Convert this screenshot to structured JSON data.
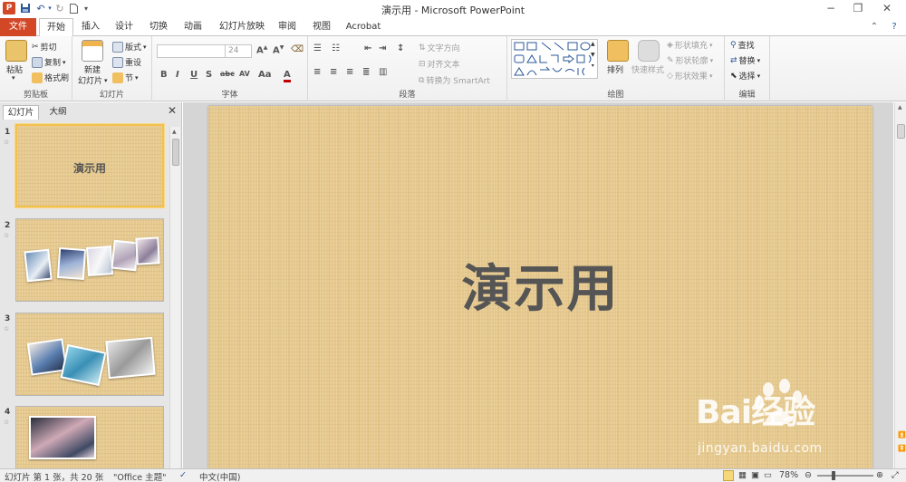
{
  "window": {
    "title": "演示用 - Microsoft PowerPoint",
    "controls": {
      "minimize": "−",
      "restore": "❐",
      "close": "✕"
    }
  },
  "tabs": [
    {
      "label": "文件",
      "state": "file"
    },
    {
      "label": "开始",
      "state": "active"
    },
    {
      "label": "插入"
    },
    {
      "label": "设计"
    },
    {
      "label": "切换"
    },
    {
      "label": "动画"
    },
    {
      "label": "幻灯片放映"
    },
    {
      "label": "审阅"
    },
    {
      "label": "视图"
    },
    {
      "label": "Acrobat"
    }
  ],
  "ribbon": {
    "clipboard": {
      "label": "剪贴板",
      "paste": "粘贴",
      "cut": "剪切",
      "copy": "复制",
      "format_painter": "格式刷"
    },
    "slides": {
      "label": "幻灯片",
      "new_slide": "新建",
      "new_slide_2": "幻灯片",
      "layout": "版式",
      "reset": "重设",
      "section": "节"
    },
    "font": {
      "label": "字体",
      "font_name": "",
      "font_size": "24"
    },
    "paragraph": {
      "label": "段落",
      "text_direction": "文字方向",
      "align_text": "对齐文本",
      "smartart": "转换为 SmartArt"
    },
    "drawing": {
      "label": "绘图",
      "arrange": "排列",
      "quick_styles": "快速样式",
      "shape_fill": "形状填充",
      "shape_outline": "形状轮廓",
      "shape_effects": "形状效果"
    },
    "editing": {
      "label": "编辑",
      "find": "查找",
      "replace": "替换",
      "select": "选择"
    }
  },
  "left_panel": {
    "tabs": [
      "幻灯片",
      "大纲"
    ],
    "thumbnails": [
      {
        "number": "1",
        "title": "演示用",
        "selected": true
      },
      {
        "number": "2"
      },
      {
        "number": "3"
      },
      {
        "number": "4"
      }
    ]
  },
  "slide": {
    "title": "演示用",
    "background_color": "#e6c98e"
  },
  "status_bar": {
    "slide_info": "幻灯片 第 1 张，共 20 张",
    "theme": "\"Office 主题\"",
    "language": "中文(中国)",
    "zoom": "78%"
  },
  "watermark": {
    "text": "Bai经验",
    "url": "jingyan.baidu.com"
  },
  "colors": {
    "file_tab": "#d24726",
    "accent": "#2b579a",
    "selection": "#f2c14e"
  }
}
